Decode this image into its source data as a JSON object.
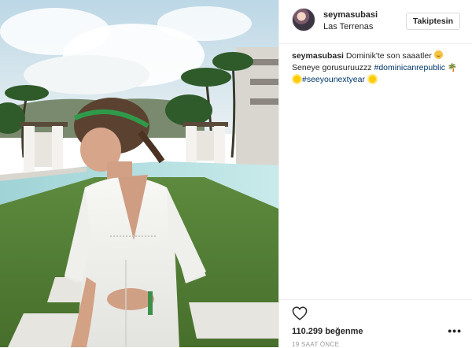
{
  "post": {
    "username": "seymasubasi",
    "location": "Las Terrenas",
    "follow_label": "Takiptesin",
    "caption": {
      "user": "seymasubasi",
      "line1": "Dominik'te son saaatler",
      "line2": "Seneye gorusuruuzzz",
      "hashtag1": "#dominicanrepublic",
      "hashtag2": "#seeyounextyear"
    },
    "likes": "110.299 beğenme",
    "time": "19 SAAT ÖNCE"
  },
  "icons": {
    "heart": "heart-icon",
    "more": "more-options-icon"
  },
  "colors": {
    "hashtag": "#003569",
    "text": "#262626",
    "muted": "#999999",
    "divider": "#efefef"
  }
}
